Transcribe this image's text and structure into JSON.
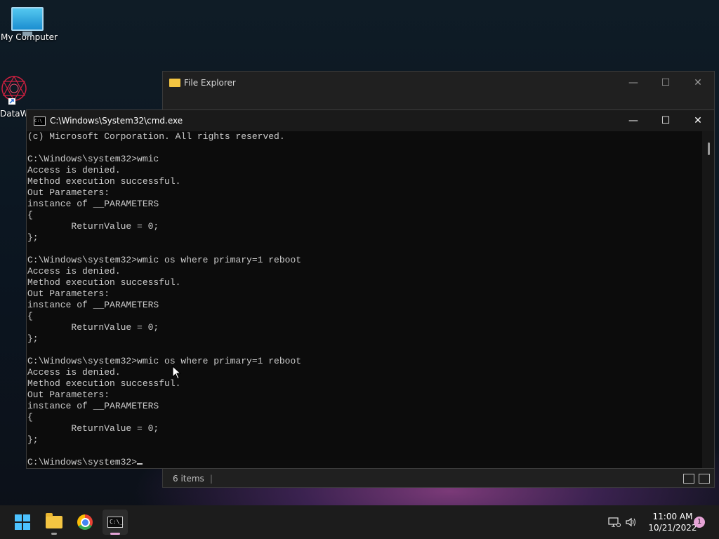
{
  "desktop": {
    "icons": [
      {
        "label": "My Computer"
      },
      {
        "label": "DataWarehouse"
      }
    ]
  },
  "file_explorer": {
    "title": "File Explorer",
    "status_items": "6 items"
  },
  "cmd": {
    "title": "C:\\Windows\\System32\\cmd.exe",
    "lines": [
      "(c) Microsoft Corporation. All rights reserved.",
      "",
      "C:\\Windows\\system32>wmic",
      "Access is denied.",
      "Method execution successful.",
      "Out Parameters:",
      "instance of __PARAMETERS",
      "{",
      "        ReturnValue = 0;",
      "};",
      "",
      "C:\\Windows\\system32>wmic os where primary=1 reboot",
      "Access is denied.",
      "Method execution successful.",
      "Out Parameters:",
      "instance of __PARAMETERS",
      "{",
      "        ReturnValue = 0;",
      "};",
      "",
      "C:\\Windows\\system32>wmic os where primary=1 reboot",
      "Access is denied.",
      "Method execution successful.",
      "Out Parameters:",
      "instance of __PARAMETERS",
      "{",
      "        ReturnValue = 0;",
      "};",
      ""
    ],
    "prompt": "C:\\Windows\\system32>"
  },
  "window_buttons": {
    "minimize": "—",
    "maximize": "☐",
    "close": "✕"
  },
  "taskbar": {
    "time": "11:00 AM",
    "date": "10/21/2022",
    "notification_count": "1"
  },
  "colors": {
    "accent": "#4cc2ff",
    "cmd_text": "#cccccc"
  }
}
